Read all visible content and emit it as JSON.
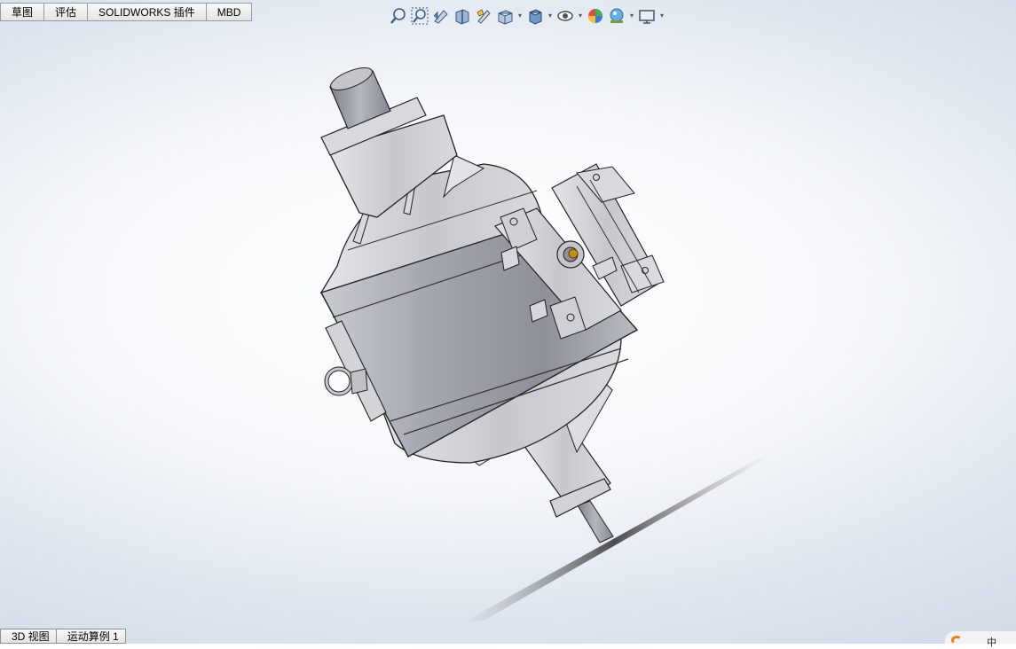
{
  "tabs": [
    "草图",
    "评估",
    "SOLIDWORKS 插件",
    "MBD"
  ],
  "bottom_tabs": [
    "3D 视图",
    "运动算例 1"
  ],
  "toolbar": {
    "icons": [
      "zoom-to-fit-icon",
      "zoom-to-area-icon",
      "previous-view-icon",
      "section-view-icon",
      "dynamic-annotation-icon",
      "view-orientation-icon",
      "display-style-icon",
      "hide-show-items-icon",
      "edit-appearance-icon",
      "apply-scene-icon",
      "view-settings-icon"
    ]
  },
  "status": {
    "corner_glyph": "中"
  },
  "colors": {
    "logo": "#f07c18",
    "background": "#ffffff",
    "part_gray": "#a9abb3"
  }
}
